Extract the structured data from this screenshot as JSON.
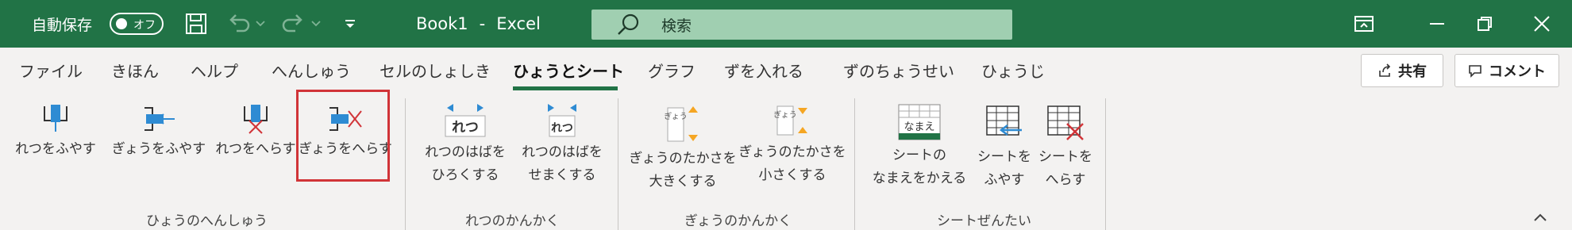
{
  "titlebar": {
    "autosave_label": "自動保存",
    "toggle_label": "オフ",
    "doc_name": "Book1",
    "separator": "-",
    "app_name": "Excel",
    "search_placeholder": "検索"
  },
  "tabs": [
    {
      "label": "ファイル"
    },
    {
      "label": "きほん"
    },
    {
      "label": "ヘルプ"
    },
    {
      "label": "へんしゅう"
    },
    {
      "label": "セルのしょしき"
    },
    {
      "label": "ひょうとシート"
    },
    {
      "label": "グラフ"
    },
    {
      "label": "ずを入れる"
    },
    {
      "label": "ずのちょうせい"
    },
    {
      "label": "ひょうじ"
    }
  ],
  "share_label": "共有",
  "comment_label": "コメント",
  "groups": [
    {
      "label": "ひょうのへんしゅう",
      "buttons": [
        {
          "l1": "れつをふやす",
          "l2": ""
        },
        {
          "l1": "ぎょうをふやす",
          "l2": ""
        },
        {
          "l1": "れつをへらす",
          "l2": ""
        },
        {
          "l1": "ぎょうをへらす",
          "l2": ""
        }
      ]
    },
    {
      "label": "れつのかんかく",
      "buttons": [
        {
          "l1": "れつのはばを",
          "l2": "ひろくする",
          "icon_text": "れつ"
        },
        {
          "l1": "れつのはばを",
          "l2": "せまくする",
          "icon_text": "れつ"
        }
      ]
    },
    {
      "label": "ぎょうのかんかく",
      "buttons": [
        {
          "l1": "ぎょうのたかさを",
          "l2": "大きくする",
          "icon_text": "ぎょう"
        },
        {
          "l1": "ぎょうのたかさを",
          "l2": "小さくする",
          "icon_text": "ぎょう"
        }
      ]
    },
    {
      "label": "シートぜんたい",
      "buttons": [
        {
          "l1": "シートの",
          "l2": "なまえをかえる",
          "icon_text": "なまえ"
        },
        {
          "l1": "シートを",
          "l2": "ふやす"
        },
        {
          "l1": "シートを",
          "l2": "へらす"
        }
      ]
    }
  ],
  "colors": {
    "excel_green": "#217346",
    "accent_blue": "#2e8bd3",
    "delete_red": "#d13438",
    "orange": "#f5a623",
    "highlight": "#d13438"
  }
}
